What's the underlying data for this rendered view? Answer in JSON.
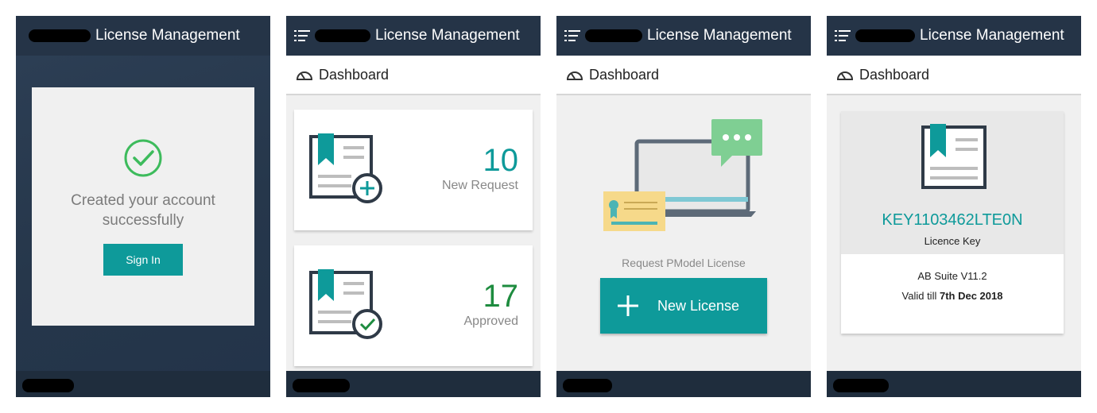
{
  "app": {
    "title": "License Management"
  },
  "screen1": {
    "message_line1": "Created your account",
    "message_line2": "successfully",
    "signin_label": "Sign In"
  },
  "dashboard": {
    "label": "Dashboard"
  },
  "screen2": {
    "new_request": {
      "count": "10",
      "label": "New Request",
      "color": "#0e9a9a"
    },
    "approved": {
      "count": "17",
      "label": "Approved",
      "color": "#1e8c3f"
    }
  },
  "screen3": {
    "request_label": "Request PModel License",
    "new_license_label": "New License"
  },
  "screen4": {
    "key": "KEY1103462LTE0N",
    "key_label": "Licence Key",
    "product": "AB Suite V11.2",
    "valid_prefix": "Valid till ",
    "valid_date": "7th Dec 2018"
  },
  "colors": {
    "accent": "#0e9a9a",
    "topbar": "#253447",
    "success": "#3dbb5c"
  },
  "icons": [
    "menu-icon",
    "dashboard-gauge-icon",
    "check-circle-icon",
    "license-add-icon",
    "license-approved-icon",
    "plus-icon",
    "license-icon"
  ]
}
